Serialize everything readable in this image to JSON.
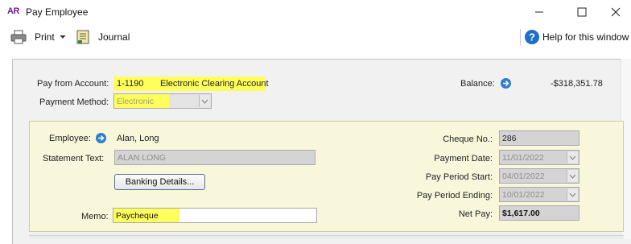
{
  "window": {
    "app_badge": "AR",
    "title": "Pay Employee"
  },
  "toolbar": {
    "print_label": "Print",
    "journal_label": "Journal",
    "help_label": "Help for this window"
  },
  "account": {
    "label": "Pay from Account:",
    "number": "1-1190",
    "name": "Electronic Clearing Account",
    "highlight_color": "#ffff5c"
  },
  "payment_method": {
    "label": "Payment Method:",
    "value": "Electronic"
  },
  "balance": {
    "label": "Balance:",
    "value": "-$318,351.78"
  },
  "employee": {
    "label": "Employee:",
    "value": "Alan, Long"
  },
  "statement_text": {
    "label": "Statement Text:",
    "value": "ALAN LONG"
  },
  "banking_button": "Banking Details...",
  "memo": {
    "label": "Memo:",
    "value": "Paycheque"
  },
  "cheque_no": {
    "label": "Cheque No.:",
    "value": "286"
  },
  "payment_date": {
    "label": "Payment Date:",
    "value": "11/01/2022"
  },
  "pay_period_start": {
    "label": "Pay Period Start:",
    "value": "04/01/2022"
  },
  "pay_period_ending": {
    "label": "Pay Period Ending:",
    "value": "10/01/2022"
  },
  "net_pay": {
    "label": "Net Pay:",
    "value": "$1,617.00"
  },
  "colors": {
    "panel_background": "#f8f6db",
    "accent_blue": "#2d7ed0",
    "logo_purple": "#6b1f8a"
  }
}
